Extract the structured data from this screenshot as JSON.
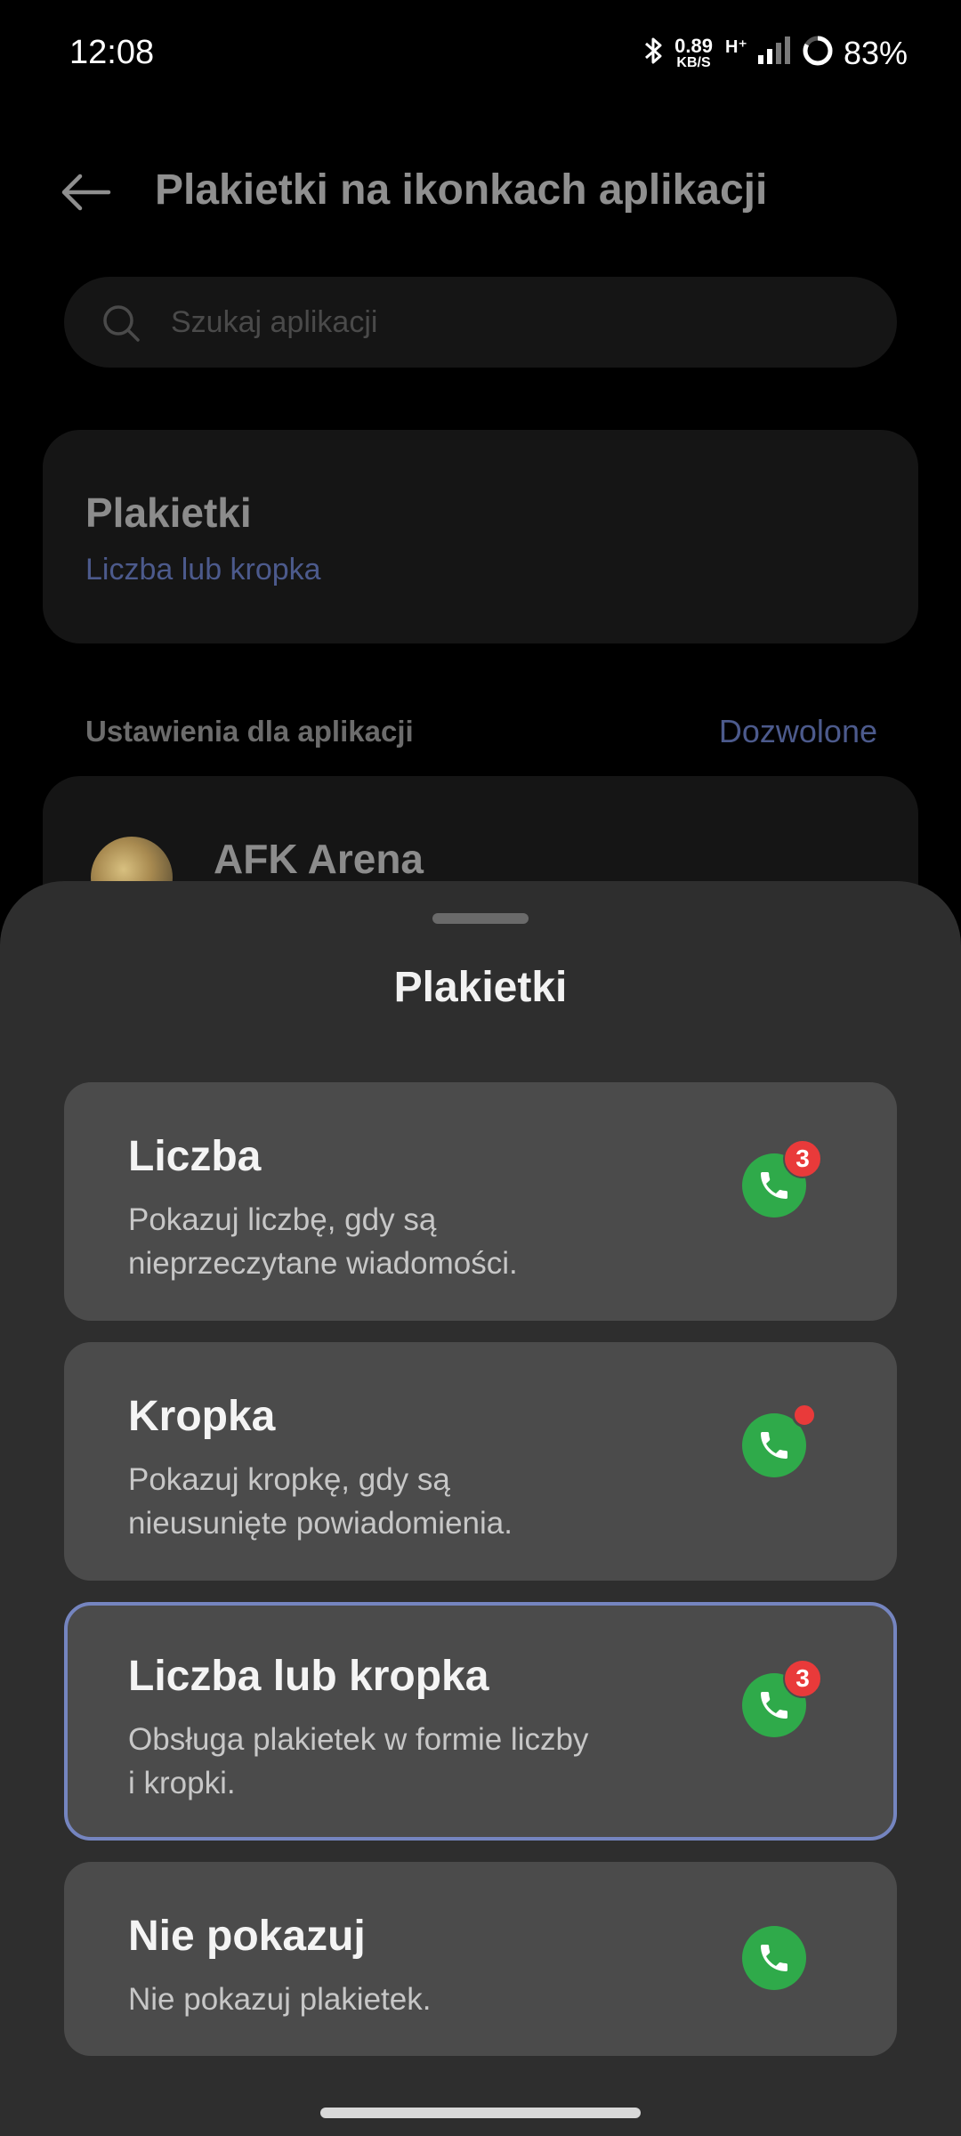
{
  "status_bar": {
    "time": "12:08",
    "net_speed_value": "0.89",
    "net_speed_unit": "KB/S",
    "network_type": "H⁺",
    "battery": "83%"
  },
  "header": {
    "title": "Plakietki na ikonkach aplikacji"
  },
  "search": {
    "placeholder": "Szukaj aplikacji"
  },
  "badges_setting": {
    "title": "Plakietki",
    "value": "Liczba lub kropka"
  },
  "app_settings": {
    "label": "Ustawienia dla aplikacji",
    "filter": "Dozwolone",
    "apps": [
      {
        "name": "AFK Arena"
      }
    ]
  },
  "sheet": {
    "title": "Plakietki",
    "options": [
      {
        "title": "Liczba",
        "description": "Pokazuj liczbę, gdy są nieprzeczytane wiadomości.",
        "badge": "3"
      },
      {
        "title": "Kropka",
        "description": "Pokazuj kropkę, gdy są nieusunięte powiadomienia."
      },
      {
        "title": "Liczba lub kropka",
        "description": "Obsługa plakietek w formie liczby i kropki.",
        "badge": "3",
        "selected": true
      },
      {
        "title": "Nie pokazuj",
        "description": "Nie pokazuj plakietek."
      }
    ]
  },
  "colors": {
    "accent": "#7585c0",
    "sheet_bg": "#2e2e2e",
    "option_bg": "#4b4b4b",
    "phone_green": "#2faa4a",
    "badge_red": "#e93a3a"
  }
}
